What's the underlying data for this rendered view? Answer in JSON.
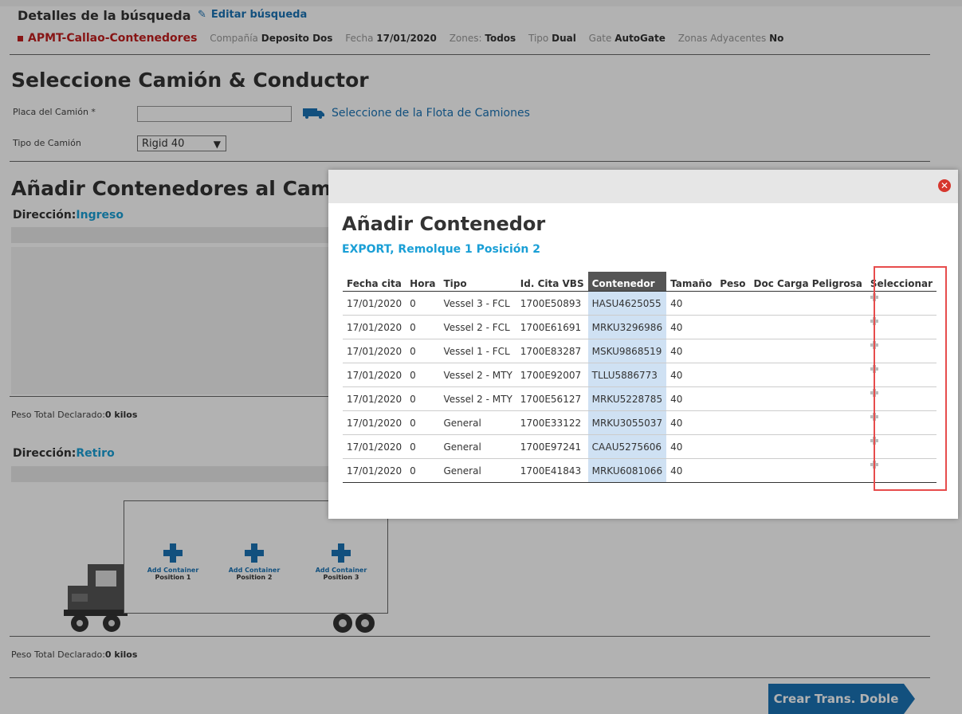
{
  "search_details": {
    "title": "Detalles de la búsqueda",
    "edit_link": "Editar búsqueda",
    "terminal": "APMT-Callao-Contenedores",
    "criteria": [
      {
        "label": "Compañía",
        "value": "Deposito Dos"
      },
      {
        "label": "Fecha",
        "value": "17/01/2020"
      },
      {
        "label": "Zones:",
        "value": "Todos"
      },
      {
        "label": "Tipo",
        "value": "Dual"
      },
      {
        "label": "Gate",
        "value": "AutoGate"
      },
      {
        "label": "Zonas Adyacentes",
        "value": "No"
      }
    ]
  },
  "truck_driver": {
    "heading": "Seleccione Camión & Conductor",
    "plate_label": "Placa del Camión *",
    "plate_value": "",
    "fleet_link": "Seleccione de la Flota de Camiones",
    "type_label": "Tipo de Camión",
    "type_value": "Rigid 40"
  },
  "add_containers": {
    "heading": "Añadir Contenedores al Camión",
    "direction_label": "Dirección:",
    "direction_ingreso": "Ingreso",
    "direction_retiro": "Retiro",
    "peso_label": "Peso Total Declarado:",
    "peso_value": "0 kilos",
    "positions": [
      {
        "line1": "Add Container",
        "line2": "Position 1"
      },
      {
        "line1": "Add Container",
        "line2": "Position 2"
      },
      {
        "line1": "Add Container",
        "line2": "Position 3"
      }
    ],
    "double_button": "Crear Trans. Doble"
  },
  "modal": {
    "title": "Añadir Contenedor",
    "subtitle": "EXPORT, Remolque 1 Posición 2",
    "columns": [
      "Fecha cita",
      "Hora",
      "Tipo",
      "Id. Cita VBS",
      "Contenedor",
      "Tamaño",
      "Peso",
      "Doc Carga Peligrosa",
      "Seleccionar"
    ],
    "rows": [
      {
        "fecha": "17/01/2020",
        "hora": "0",
        "tipo": "Vessel 3 - FCL",
        "id": "1700E50893",
        "contenedor": "HASU4625055",
        "tamano": "40"
      },
      {
        "fecha": "17/01/2020",
        "hora": "0",
        "tipo": "Vessel 2 - FCL",
        "id": "1700E61691",
        "contenedor": "MRKU3296986",
        "tamano": "40"
      },
      {
        "fecha": "17/01/2020",
        "hora": "0",
        "tipo": "Vessel 1 - FCL",
        "id": "1700E83287",
        "contenedor": "MSKU9868519",
        "tamano": "40"
      },
      {
        "fecha": "17/01/2020",
        "hora": "0",
        "tipo": "Vessel 2 - MTY",
        "id": "1700E92007",
        "contenedor": "TLLU5886773",
        "tamano": "40"
      },
      {
        "fecha": "17/01/2020",
        "hora": "0",
        "tipo": "Vessel 2 - MTY",
        "id": "1700E56127",
        "contenedor": "MRKU5228785",
        "tamano": "40"
      },
      {
        "fecha": "17/01/2020",
        "hora": "0",
        "tipo": "General",
        "id": "1700E33122",
        "contenedor": "MRKU3055037",
        "tamano": "40"
      },
      {
        "fecha": "17/01/2020",
        "hora": "0",
        "tipo": "General",
        "id": "1700E97241",
        "contenedor": "CAAU5275606",
        "tamano": "40"
      },
      {
        "fecha": "17/01/2020",
        "hora": "0",
        "tipo": "General",
        "id": "1700E41843",
        "contenedor": "MRKU6081066",
        "tamano": "40"
      }
    ]
  },
  "colors": {
    "accent_blue": "#1a73b5",
    "link_cyan": "#1a9fd6",
    "terminal_red": "#c21f1f",
    "highlight_box": "#e74c4c"
  }
}
